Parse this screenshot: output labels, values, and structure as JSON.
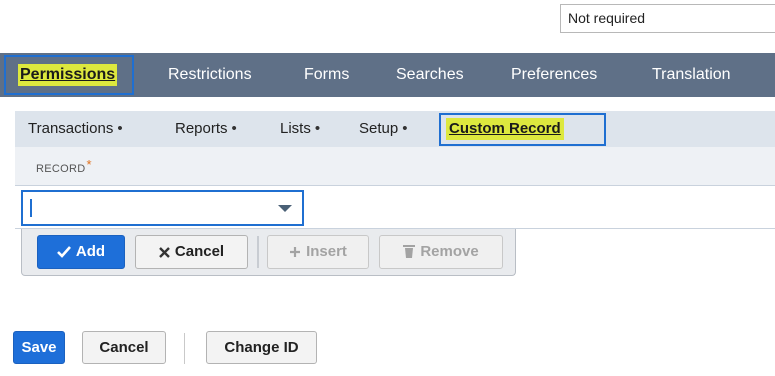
{
  "top_select": {
    "value": "Not required"
  },
  "main_tabs": [
    {
      "label": "Permissions",
      "underline_char": "P"
    },
    {
      "label": "Restrictions",
      "underline_char": "R"
    },
    {
      "label": "Forms",
      "underline_char": "F"
    },
    {
      "label": "Searches",
      "underline_char": "S"
    },
    {
      "label": "Preferences",
      "underline_char": "e"
    },
    {
      "label": "Translation",
      "underline_char": "T"
    }
  ],
  "sub_tabs": [
    {
      "label": "Transactions",
      "bullet": "•"
    },
    {
      "label": "Reports",
      "bullet": "•"
    },
    {
      "label": "Lists",
      "bullet": "•"
    },
    {
      "label": "Setup",
      "bullet": "•"
    },
    {
      "label": "Custom Record"
    }
  ],
  "grid": {
    "column_label": "RECORD",
    "required_mark": "*",
    "record_value": ""
  },
  "row_buttons": {
    "add": "Add",
    "cancel": "Cancel",
    "insert": "Insert",
    "remove": "Remove"
  },
  "footer_buttons": {
    "save": "Save",
    "cancel": "Cancel",
    "change_id": "Change ID"
  },
  "colors": {
    "tab_bar": "#5f7087",
    "highlight": "#dde83e",
    "focus": "#1f6fd1",
    "primary_button": "#1e6fd9"
  },
  "icons": {
    "add": "check-icon",
    "cancel": "x-icon",
    "insert": "plus-icon",
    "remove": "trash-icon",
    "dropdown": "chevron-down-icon"
  }
}
